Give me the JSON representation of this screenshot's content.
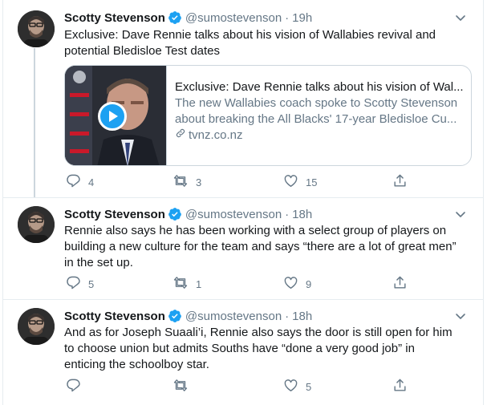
{
  "colors": {
    "accent": "#1da1f2",
    "text_primary": "#14171a",
    "text_secondary": "#657786",
    "border": "#e6ecf0",
    "thread_line": "#ccd6dd"
  },
  "tweets": [
    {
      "author_name": "Scotty Stevenson",
      "handle": "@sumostevenson",
      "separator": "·",
      "time": "19h",
      "verified_icon": "verified-badge-icon",
      "text_lines": [
        "Exclusive: Dave Rennie talks about his vision of Wallabies revival and",
        "potential Bledisloe Test dates"
      ],
      "card": {
        "title": "Exclusive: Dave Rennie talks about his vision of Wal...",
        "description_lines": [
          "The new Wallabies coach spoke to Scotty Stevenson",
          "about breaking the All Blacks' 17-year Bledisloe Cu..."
        ],
        "domain": "tvnz.co.nz",
        "play_icon": "play-icon",
        "link_icon": "link-icon"
      },
      "replies": "4",
      "retweets": "3",
      "likes": "15"
    },
    {
      "author_name": "Scotty Stevenson",
      "handle": "@sumostevenson",
      "separator": "·",
      "time": "18h",
      "verified_icon": "verified-badge-icon",
      "text_lines": [
        "Rennie also says he has been working with a select group of players on",
        "building a new culture for the team and says “there are a lot of great men”",
        "in the set up."
      ],
      "replies": "5",
      "retweets": "1",
      "likes": "9"
    },
    {
      "author_name": "Scotty Stevenson",
      "handle": "@sumostevenson",
      "separator": "·",
      "time": "18h",
      "verified_icon": "verified-badge-icon",
      "text_lines": [
        "And as for Joseph Suaali’i, Rennie also says the door is still open for him",
        "to choose union but admits Souths have “done a very good job” in",
        "enticing the schoolboy star."
      ],
      "replies": "",
      "retweets": "",
      "likes": "5"
    }
  ],
  "icons": {
    "reply": "reply-icon",
    "retweet": "retweet-icon",
    "like": "like-icon",
    "share": "share-icon",
    "caret": "chevron-down-icon"
  }
}
